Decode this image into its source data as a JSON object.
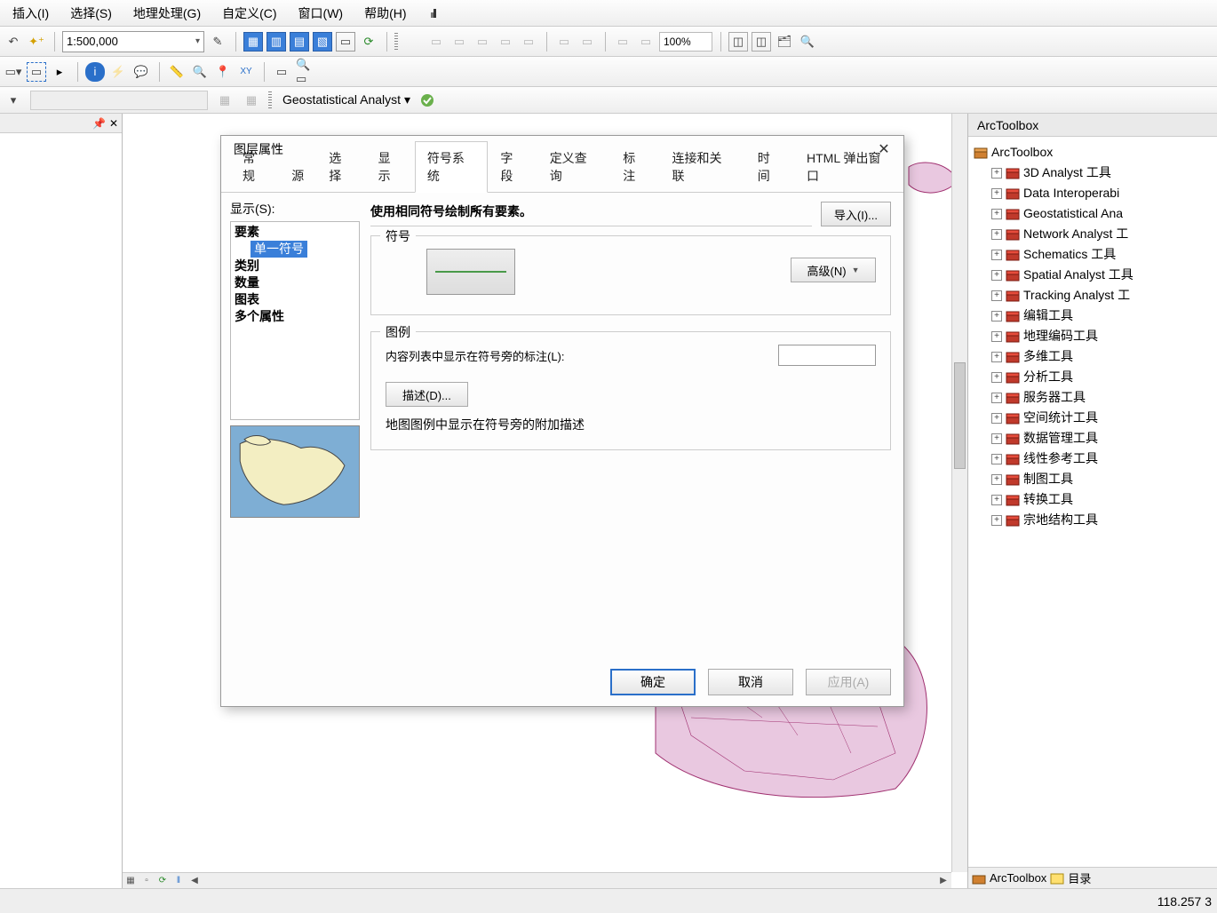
{
  "menu": {
    "insert": "插入(I)",
    "select": "选择(S)",
    "geoproc": "地理处理(G)",
    "custom": "自定义(C)",
    "window": "窗口(W)",
    "help": "帮助(H)"
  },
  "toolbar": {
    "scale": "1:500,000",
    "zoom": "100%"
  },
  "geostat": {
    "label": "Geostatistical Analyst ▾"
  },
  "modal": {
    "title": "图层属性",
    "tabs": {
      "general": "常规",
      "source": "源",
      "selection": "选择",
      "display": "显示",
      "symbology": "符号系统",
      "fields": "字段",
      "defquery": "定义查询",
      "labels": "标注",
      "joins": "连接和关联",
      "time": "时间",
      "html": "HTML 弹出窗口"
    },
    "show_label": "显示(S):",
    "tree": {
      "features": "要素",
      "single": "单一符号",
      "categories": "类别",
      "quantities": "数量",
      "charts": "图表",
      "multi": "多个属性"
    },
    "summary": "使用相同符号绘制所有要素。",
    "import_btn": "导入(I)...",
    "symbol_group": "符号",
    "advanced_btn": "高级(N)",
    "legend_group": "图例",
    "legend_label": "内容列表中显示在符号旁的标注(L):",
    "desc_btn": "描述(D)...",
    "desc_hint": "地图图例中显示在符号旁的附加描述",
    "ok": "确定",
    "cancel": "取消",
    "apply": "应用(A)"
  },
  "arctoolbox": {
    "title": "ArcToolbox",
    "root": "ArcToolbox",
    "items": [
      "3D Analyst 工具",
      "Data Interoperabi",
      "Geostatistical Ana",
      "Network Analyst 工",
      "Schematics 工具",
      "Spatial Analyst 工具",
      "Tracking Analyst 工",
      "编辑工具",
      "地理编码工具",
      "多维工具",
      "分析工具",
      "服务器工具",
      "空间统计工具",
      "数据管理工具",
      "线性参考工具",
      "制图工具",
      "转换工具",
      "宗地结构工具"
    ],
    "footer_tab1": "ArcToolbox",
    "footer_tab2": "目录"
  },
  "status": {
    "coords": "118.257  3"
  }
}
